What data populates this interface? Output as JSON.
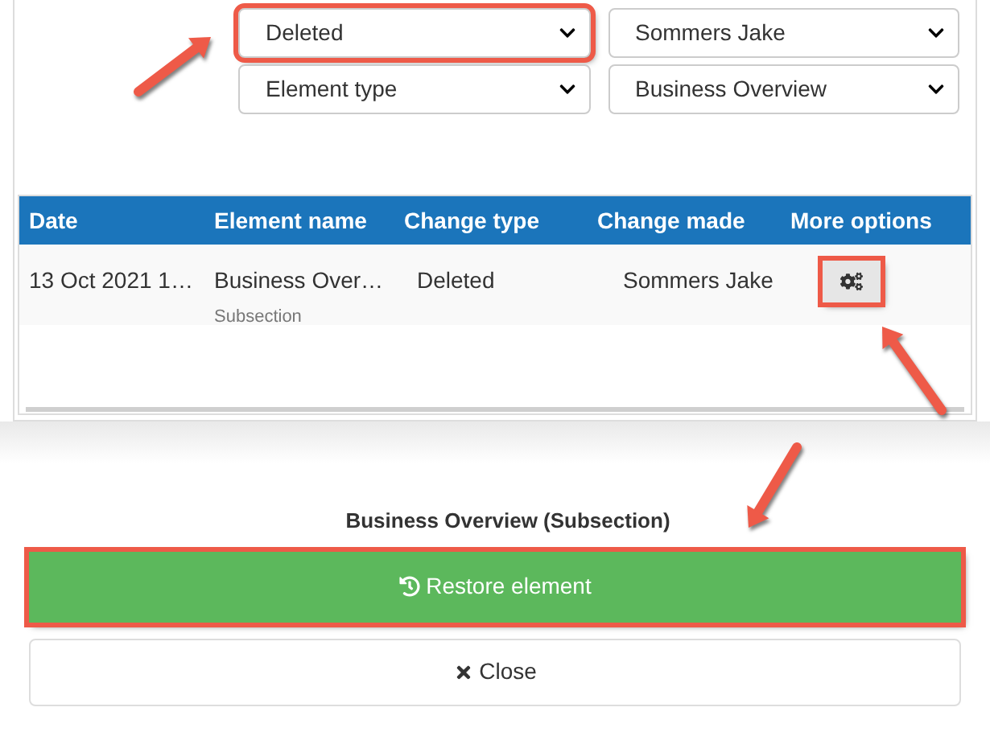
{
  "filters": [
    {
      "value": "Deleted",
      "highlighted": true
    },
    {
      "value": "Sommers Jake",
      "highlighted": false
    },
    {
      "value": "Element type",
      "highlighted": false
    },
    {
      "value": "Business Overview",
      "highlighted": false
    }
  ],
  "table": {
    "columns": [
      "Date",
      "Element name",
      "Change type",
      "Change made",
      "More options"
    ],
    "rows": [
      {
        "date": "13 Oct 2021 1…",
        "element_name": "Business Over…",
        "element_type": "Subsection",
        "change_type": "Deleted",
        "change_made": "Sommers Jake",
        "options_highlighted": true
      }
    ]
  },
  "dialog": {
    "title": "Business Overview (Subsection)",
    "buttons": [
      {
        "kind": "restore",
        "label": "Restore element",
        "highlighted": true
      },
      {
        "kind": "close",
        "label": "Close",
        "highlighted": false
      }
    ]
  }
}
